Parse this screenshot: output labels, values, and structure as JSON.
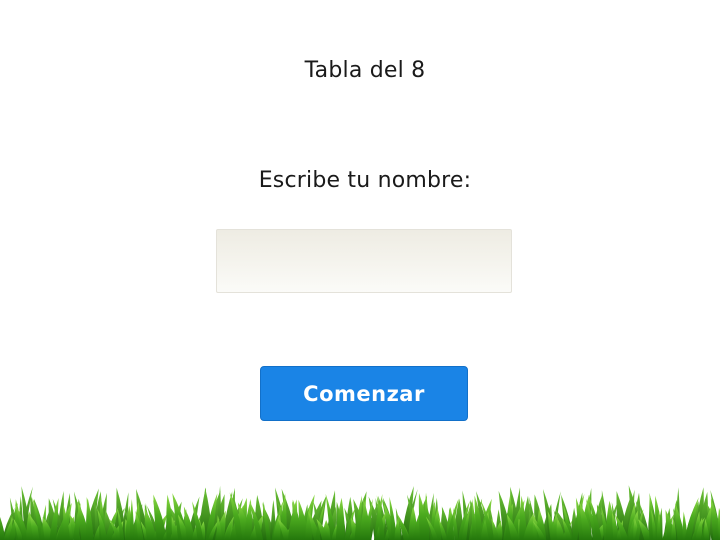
{
  "app": {
    "title": "Tabla del 8",
    "prompt": "Escribe tu nombre:"
  },
  "form": {
    "name_value": "",
    "name_placeholder": "",
    "start_label": "Comenzar"
  },
  "colors": {
    "button": "#1a84e6",
    "grass_dark": "#2e8a10",
    "grass_light": "#7fd33a"
  }
}
